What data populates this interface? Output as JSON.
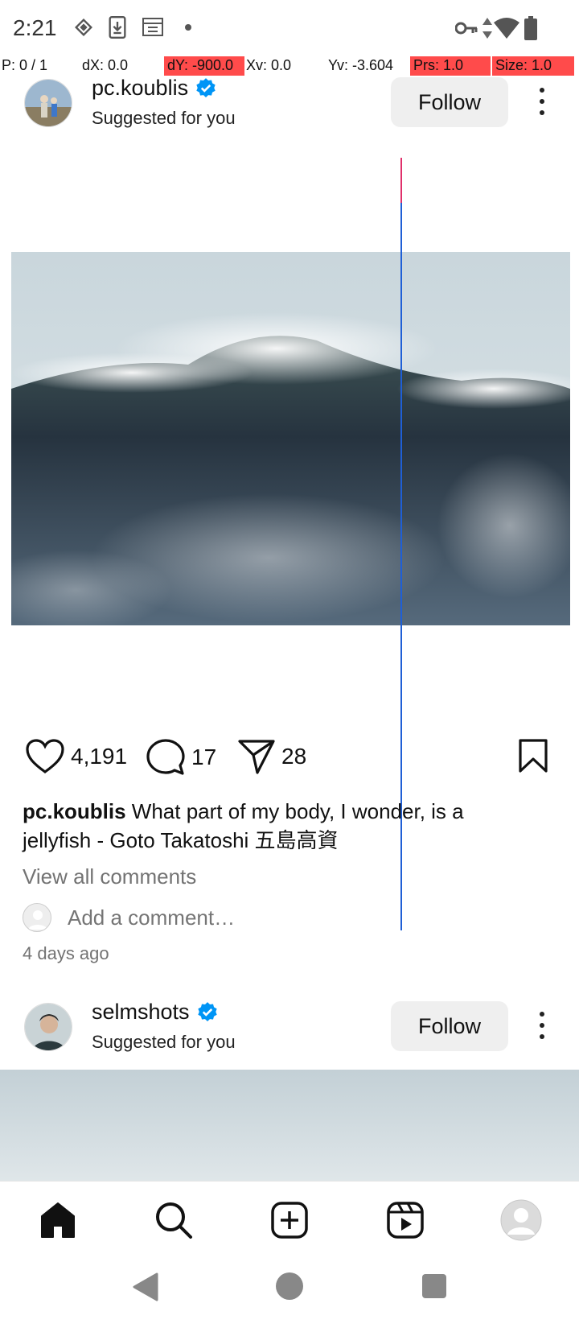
{
  "status_bar": {
    "time": "2:21",
    "icons_left": [
      "vpn-key-icon",
      "download-icon",
      "calendar-icon",
      "dot-icon"
    ],
    "icons_right": [
      "key-icon",
      "data-arrows-icon",
      "wifi-icon",
      "battery-icon"
    ]
  },
  "pointer_overlay": {
    "p": "P: 0 / 1",
    "dx": "dX: 0.0",
    "dy": "dY: -900.0",
    "xv": "Xv: 0.0",
    "yv": "Yv: -3.604",
    "prs": "Prs: 1.0",
    "size": "Size: 1.0",
    "highlight_color": "#ff4b4b",
    "line_color": "#1f5fd6"
  },
  "posts": [
    {
      "username": "pc.koublis",
      "verified": true,
      "subtitle": "Suggested for you",
      "follow_label": "Follow",
      "likes": "4,191",
      "comments": "17",
      "shares": "28",
      "caption_user": "pc.koublis",
      "caption_text": " What part of my body, I wonder, is a jellyfish - Goto Takatoshi 五島高資",
      "view_comments": "View all comments",
      "add_comment_placeholder": "Add a comment…",
      "timestamp": "4 days ago"
    },
    {
      "username": "selmshots",
      "verified": true,
      "subtitle": "Suggested for you",
      "follow_label": "Follow"
    }
  ],
  "bottom_nav": [
    "home-icon",
    "search-icon",
    "create-icon",
    "reels-icon",
    "profile-icon"
  ],
  "system_nav": [
    "back-button",
    "home-button",
    "recents-button"
  ],
  "colors": {
    "verified_blue": "#0095f6",
    "follow_bg": "#efefef",
    "secondary_text": "#737373"
  }
}
